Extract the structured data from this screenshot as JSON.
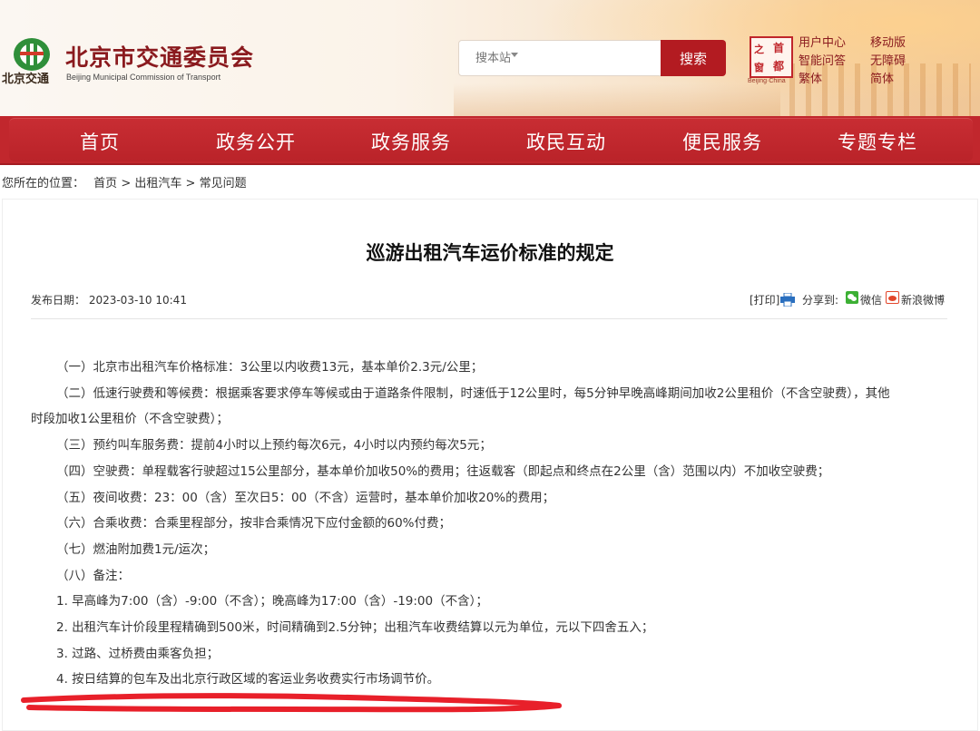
{
  "header": {
    "logo_name": "北京市交通委员会",
    "logo_en": "Beijing Municipal Commission of Transport",
    "logo_sub": "北京交通",
    "search_placeholder": "搜本站",
    "search_button": "搜索",
    "capital_seal": [
      "首",
      "都",
      "之",
      "窗"
    ],
    "capital_en": "Beijing·China",
    "links": [
      "用户中心",
      "移动版",
      "智能问答",
      "无障碍",
      "繁体",
      "简体"
    ]
  },
  "nav": {
    "items": [
      "首页",
      "政务公开",
      "政务服务",
      "政民互动",
      "便民服务",
      "专题专栏"
    ]
  },
  "breadcrumb": {
    "prefix": "您所在的位置：",
    "items": [
      "首页",
      "出租汽车",
      "常见问题"
    ],
    "separator": ">"
  },
  "article": {
    "title": "巡游出租汽车运价标准的规定",
    "pubdate": "发布日期：  2023-03-10 10:41",
    "print_label": "[打印]",
    "share_label": "分享到:",
    "share_wechat": "微信",
    "share_weibo": "新浪微博",
    "paragraphs": [
      "（一）北京市出租汽车价格标准：3公里以内收费13元，基本单价2.3元/公里；",
      "（二）低速行驶费和等候费：根据乘客要求停车等候或由于道路条件限制，时速低于12公里时，每5分钟早晚高峰期间加收2公里租价（不含空驶费），其他",
      "时段加收1公里租价（不含空驶费）；",
      "（三）预约叫车服务费：提前4小时以上预约每次6元，4小时以内预约每次5元；",
      "（四）空驶费：单程载客行驶超过15公里部分，基本单价加收50%的费用；往返载客（即起点和终点在2公里（含）范围以内）不加收空驶费；",
      "（五）夜间收费：23：00（含）至次日5：00（不含）运营时，基本单价加收20%的费用；",
      "（六）合乘收费：合乘里程部分，按非合乘情况下应付金额的60%付费；",
      "（七）燃油附加费1元/运次；",
      "（八）备注：",
      "1. 早高峰为7:00（含）-9:00（不含）；晚高峰为17:00（含）-19:00（不含）；",
      "2. 出租汽车计价段里程精确到500米，时间精确到2.5分钟；出租汽车收费结算以元为单位，元以下四舍五入；",
      "3. 过路、过桥费由乘客负担；",
      "4. 按日结算的包车及出北京行政区域的客运业务收费实行市场调节价。"
    ]
  },
  "colors": {
    "brand_red": "#c1272d",
    "logo_red": "#8a1a1e",
    "highlight_red": "#e8202a"
  }
}
